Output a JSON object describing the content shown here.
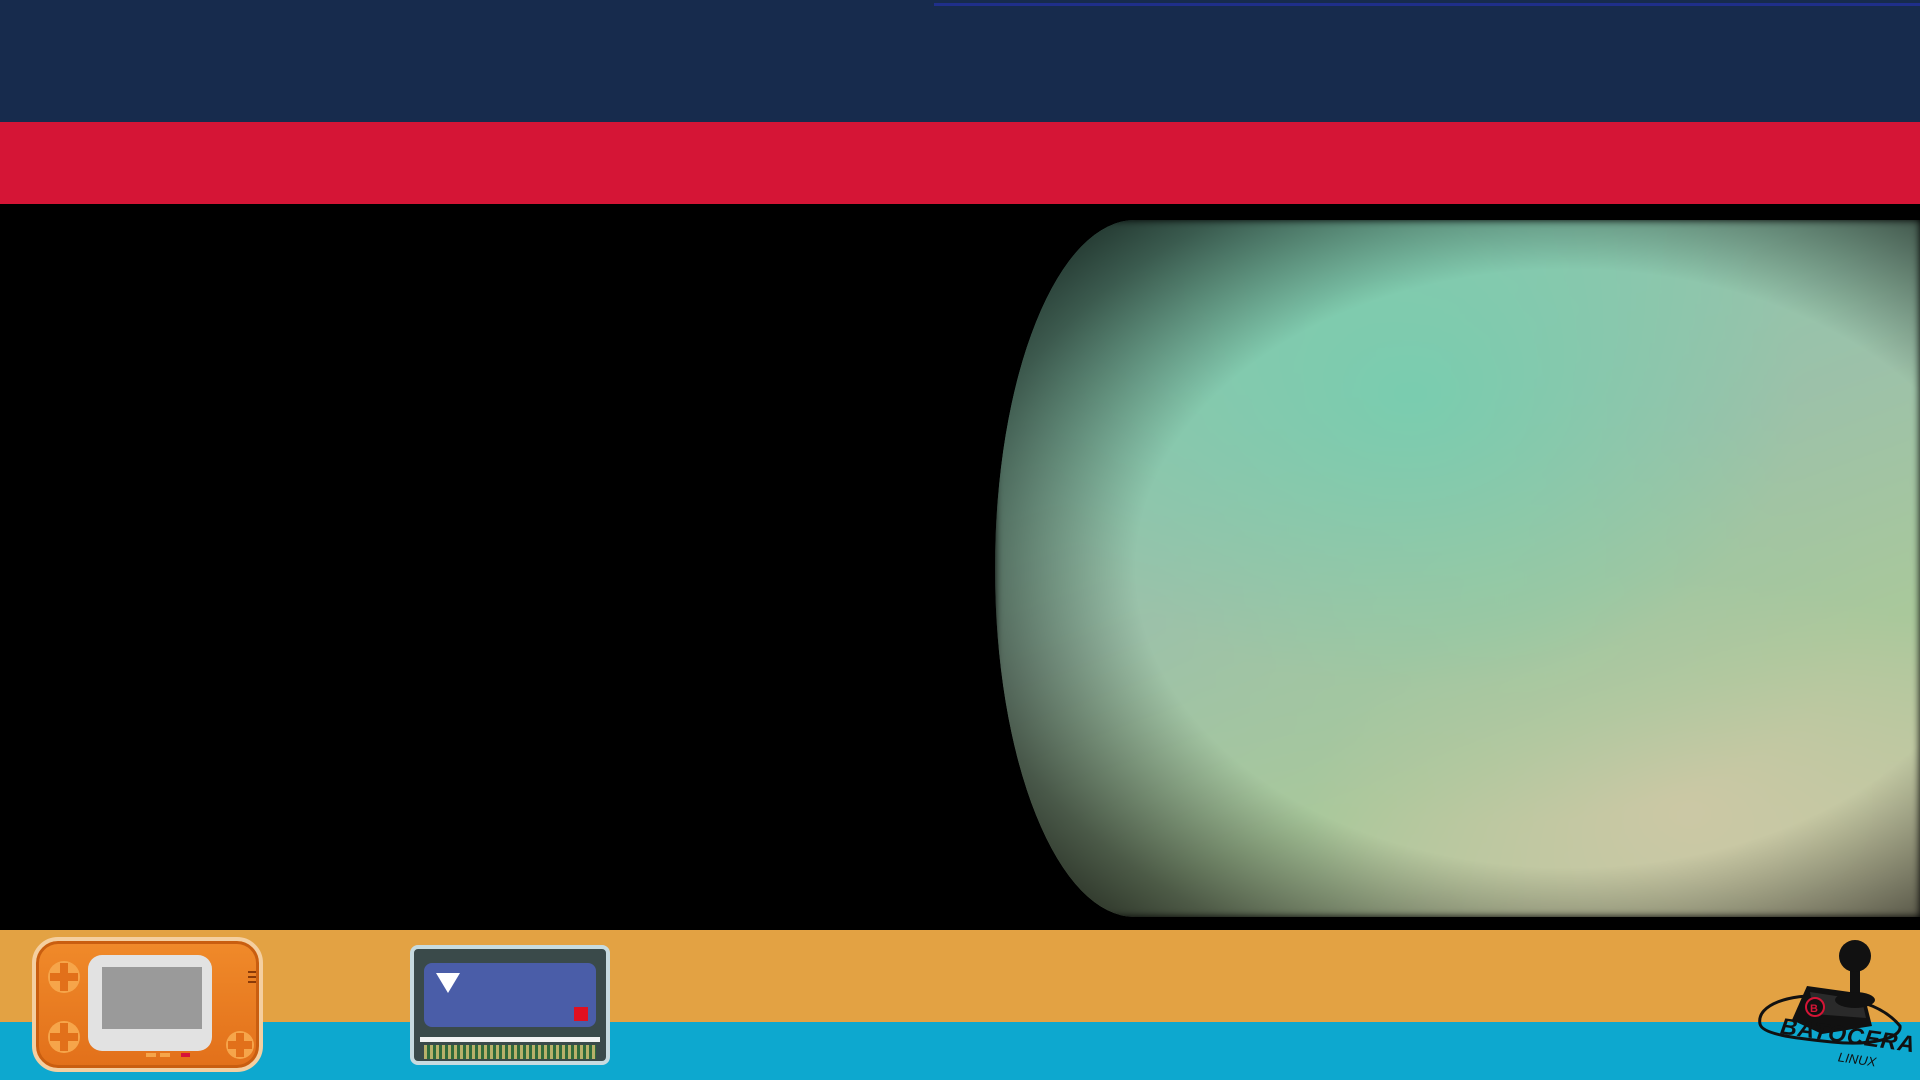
{
  "colors": {
    "top_band": "#172b4d",
    "top_line": "#1f2f8a",
    "red_band": "#d51536",
    "stage": "#000000",
    "orange_band": "#e3a243",
    "cyan_band": "#0da8cf"
  },
  "icons": {
    "console": "handheld-console-icon",
    "cartridge": "game-cartridge-icon",
    "logo": "batocera-joystick-logo"
  },
  "logo": {
    "wordmark": "BATOCERA",
    "sub": "LINUX"
  }
}
